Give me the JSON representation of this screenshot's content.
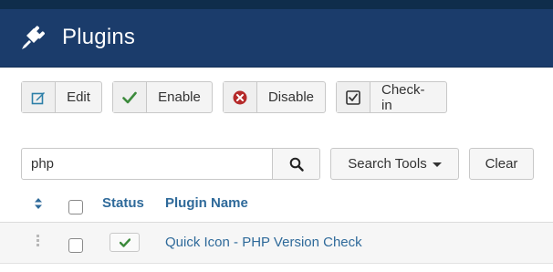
{
  "header": {
    "title": "Plugins",
    "icon": "plug-icon"
  },
  "toolbar": {
    "edit_label": "Edit",
    "enable_label": "Enable",
    "disable_label": "Disable",
    "checkin_label": "Check-in"
  },
  "search": {
    "value": "php",
    "search_tools_label": "Search Tools",
    "clear_label": "Clear"
  },
  "table": {
    "columns": {
      "status": "Status",
      "name": "Plugin Name"
    },
    "rows": [
      {
        "name": "Quick Icon - PHP Version Check",
        "enabled": true
      }
    ]
  },
  "colors": {
    "header_bg": "#1b3c6b",
    "link": "#2f6a9a",
    "enable_green": "#3c8a3c",
    "disable_red": "#b52a2a"
  }
}
